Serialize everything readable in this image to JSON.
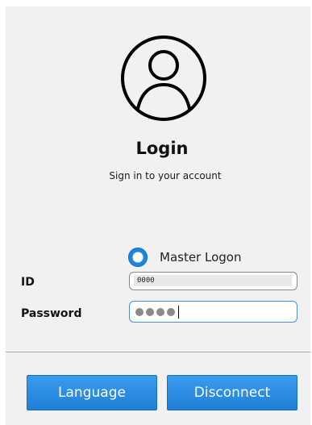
{
  "header": {
    "title": "Login",
    "subtitle": "Sign in to your account",
    "avatar_icon": "user-avatar-icon"
  },
  "master_logon": {
    "label": "Master Logon",
    "checked": true
  },
  "form": {
    "id_label": "ID",
    "id_value": "0000",
    "password_label": "Password",
    "password_masked_count": 4
  },
  "buttons": {
    "language": "Language",
    "disconnect": "Disconnect"
  },
  "colors": {
    "accent": "#1f7fd6",
    "panel_background": "#f1f1f1"
  }
}
